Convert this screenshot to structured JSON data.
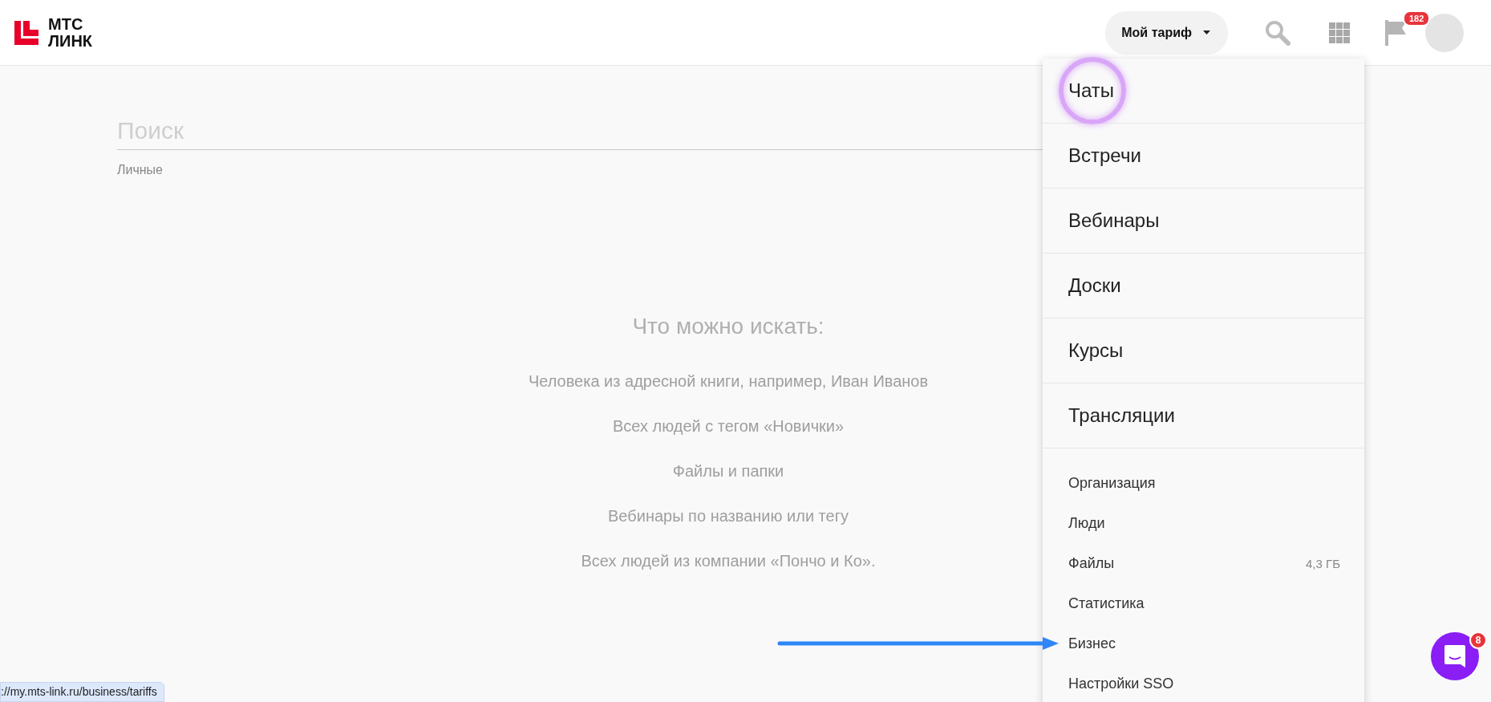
{
  "header": {
    "logo": {
      "line_1": "МТС",
      "line_2": "ЛИНК"
    },
    "plan_button": {
      "label": "Мой тариф"
    },
    "notifications_badge": "182"
  },
  "search": {
    "placeholder": "Поиск"
  },
  "filter_label": "Личные",
  "hints": {
    "title": "Что можно искать:",
    "items": [
      "Человека из адресной книги, например, Иван Иванов",
      "Всех людей с тегом «Новички»",
      "Файлы и папки",
      "Вебинары по названию или тегу",
      "Всех людей из компании «Пончо и Ко»."
    ]
  },
  "menu": {
    "primary": [
      {
        "label": "Чаты",
        "highlighted": true
      },
      {
        "label": "Встречи",
        "highlighted": false
      },
      {
        "label": "Вебинары",
        "highlighted": false
      },
      {
        "label": "Доски",
        "highlighted": false
      },
      {
        "label": "Курсы",
        "highlighted": false
      },
      {
        "label": "Трансляции",
        "highlighted": false
      }
    ],
    "secondary": [
      {
        "label": "Организация",
        "pointed": false
      },
      {
        "label": "Люди",
        "pointed": false
      },
      {
        "label": "Файлы",
        "value": "4,3 ГБ",
        "pointed": false
      },
      {
        "label": "Статистика",
        "pointed": false
      },
      {
        "label": "Бизнес",
        "pointed": true
      },
      {
        "label": "Настройки SSO",
        "pointed": false
      }
    ]
  },
  "status_url": "://my.mts-link.ru/business/tariffs",
  "chat_widget": {
    "badge": "8"
  }
}
